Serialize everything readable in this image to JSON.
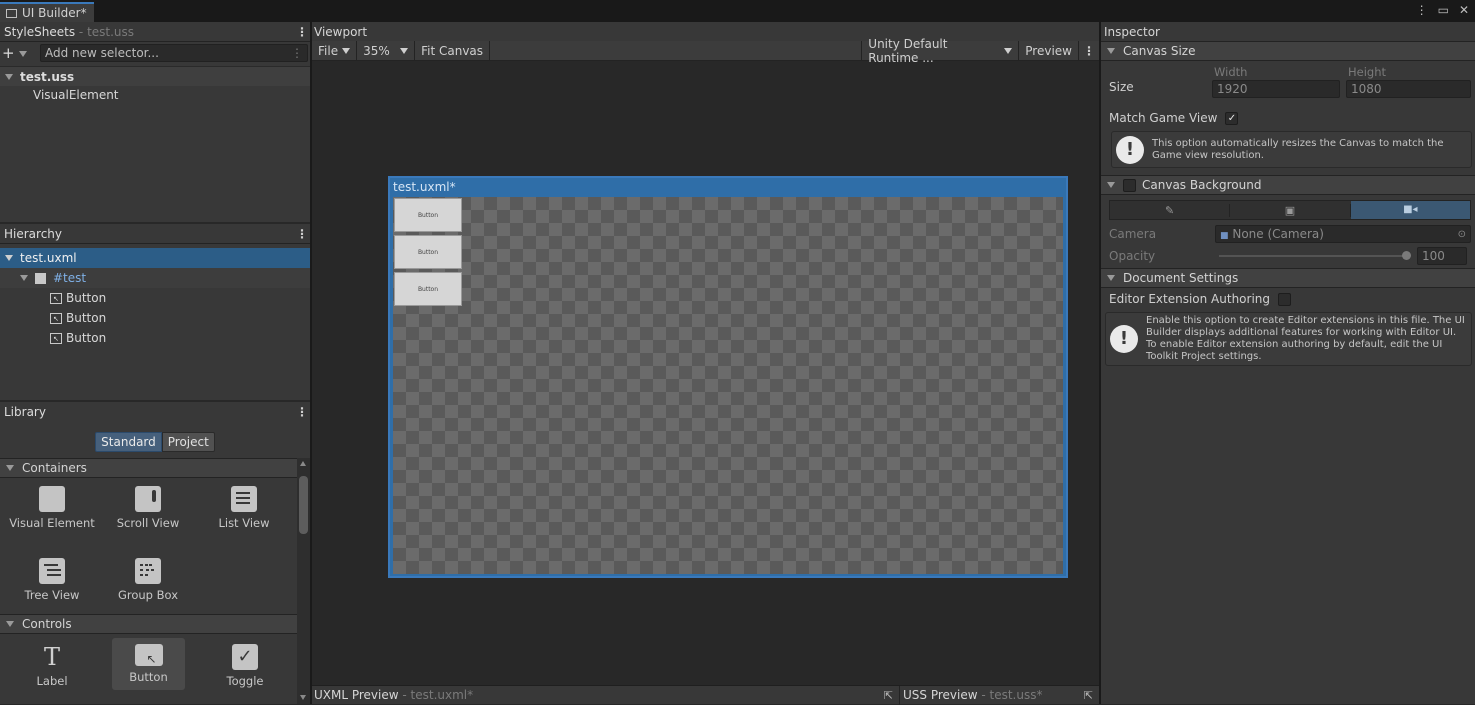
{
  "window": {
    "tab_title": "UI Builder*"
  },
  "stylesheets": {
    "title": "StyleSheets",
    "file": "test.uss",
    "selector_placeholder": "Add new selector...",
    "sheet_name": "test.uss",
    "selector_item": "VisualElement"
  },
  "hierarchy": {
    "title": "Hierarchy",
    "root": "test.uxml",
    "element": "#test",
    "children": [
      "Button",
      "Button",
      "Button"
    ]
  },
  "library": {
    "title": "Library",
    "tabs": [
      "Standard",
      "Project"
    ],
    "containers_title": "Containers",
    "containers": [
      "Visual Element",
      "Scroll View",
      "List View",
      "Tree View",
      "Group Box"
    ],
    "controls_title": "Controls",
    "controls": [
      "Label",
      "Button",
      "Toggle"
    ]
  },
  "viewport": {
    "title": "Viewport",
    "file_menu": "File",
    "zoom": "35%",
    "fit_canvas": "Fit Canvas",
    "theme": "Unity Default Runtime ...",
    "preview": "Preview",
    "canvas_title": "test.uxml*",
    "canvas_buttons": [
      "Button",
      "Button",
      "Button"
    ]
  },
  "bottom": {
    "uxml_label": "UXML Preview",
    "uxml_file": "test.uxml*",
    "uss_label": "USS Preview",
    "uss_file": "test.uss*"
  },
  "inspector": {
    "title": "Inspector",
    "canvas_size_title": "Canvas Size",
    "width_label": "Width",
    "height_label": "Height",
    "size_label": "Size",
    "width": "1920",
    "height": "1080",
    "match_game_view": "Match Game View",
    "match_help": "This option automatically resizes the Canvas to match the Game view resolution.",
    "canvas_background_title": "Canvas Background",
    "camera_label": "Camera",
    "camera_value": "None (Camera)",
    "opacity_label": "Opacity",
    "opacity_value": "100",
    "opacity_fraction": 1.0,
    "document_settings_title": "Document Settings",
    "editor_extension_label": "Editor Extension Authoring",
    "editor_help": "Enable this option to create Editor extensions in this file. The UI Builder displays additional features for working with Editor UI.\nTo enable Editor extension authoring by default, edit the UI Toolkit Project settings."
  },
  "colors": {
    "accent": "#3a79bb",
    "selection": "#2c5d87",
    "background": "#282828"
  }
}
